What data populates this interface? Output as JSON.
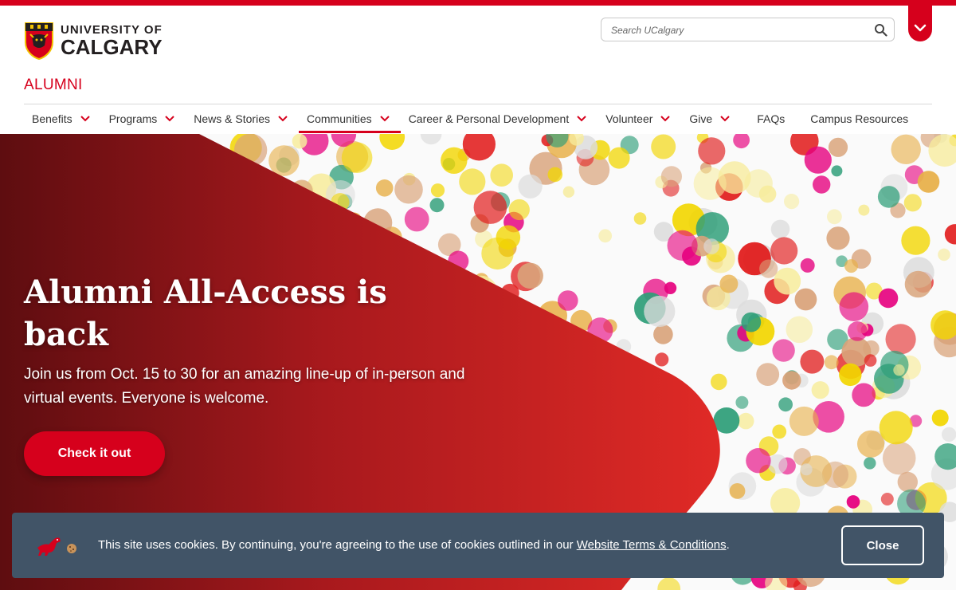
{
  "header": {
    "logo_line1": "UNIVERSITY OF",
    "logo_line2": "CALGARY",
    "section_title": "ALUMNI"
  },
  "search": {
    "placeholder": "Search UCalgary",
    "icon": "search-icon"
  },
  "nav": {
    "items": [
      {
        "label": "Benefits",
        "has_dropdown": true
      },
      {
        "label": "Programs",
        "has_dropdown": true
      },
      {
        "label": "News & Stories",
        "has_dropdown": true
      },
      {
        "label": "Communities",
        "has_dropdown": true,
        "active": true
      },
      {
        "label": "Career & Personal Development",
        "has_dropdown": true
      },
      {
        "label": "Volunteer",
        "has_dropdown": true
      },
      {
        "label": "Give",
        "has_dropdown": true
      },
      {
        "label": "FAQs",
        "has_dropdown": false
      },
      {
        "label": "Campus Resources",
        "has_dropdown": false
      }
    ]
  },
  "hero": {
    "title": "Alumni All-Access is back",
    "subtitle": "Join us from Oct. 15 to 30 for an amazing line-up of in-person and virtual events. Everyone is welcome.",
    "button_label": "Check it out"
  },
  "cookie": {
    "message": "This site uses cookies. By continuing, you're agreeing to the use of cookies outlined in our ",
    "link_text": "Website Terms & Conditions",
    "message_end": ".",
    "close_label": "Close"
  },
  "colors": {
    "brand_red": "#d6001c",
    "cookie_bg": "#415467",
    "dark_red": "#6a0e12"
  }
}
